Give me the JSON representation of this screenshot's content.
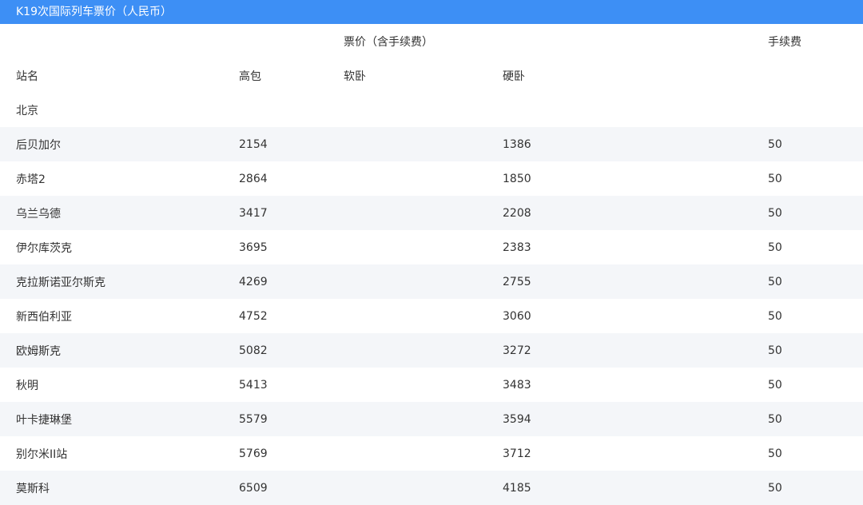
{
  "title": "K19次国际列车票价（人民币）",
  "header": {
    "group_label": "票价（含手续费）",
    "fee_label": "手续费"
  },
  "columns": [
    "站名",
    "高包",
    "软卧",
    "硬卧",
    ""
  ],
  "rows": [
    [
      "北京",
      "",
      "",
      "",
      ""
    ],
    [
      "后贝加尔",
      "2154",
      "",
      "1386",
      "50"
    ],
    [
      "赤塔2",
      "2864",
      "",
      "1850",
      "50"
    ],
    [
      "乌兰乌德",
      "3417",
      "",
      "2208",
      "50"
    ],
    [
      "伊尔库茨克",
      "3695",
      "",
      "2383",
      "50"
    ],
    [
      "克拉斯诺亚尔斯克",
      "4269",
      "",
      "2755",
      "50"
    ],
    [
      "新西伯利亚",
      "4752",
      "",
      "3060",
      "50"
    ],
    [
      "欧姆斯克",
      "5082",
      "",
      "3272",
      "50"
    ],
    [
      "秋明",
      "5413",
      "",
      "3483",
      "50"
    ],
    [
      "叶卡捷琳堡",
      "5579",
      "",
      "3594",
      "50"
    ],
    [
      "别尔米II站",
      "5769",
      "",
      "3712",
      "50"
    ],
    [
      "莫斯科",
      "6509",
      "",
      "4185",
      "50"
    ]
  ]
}
